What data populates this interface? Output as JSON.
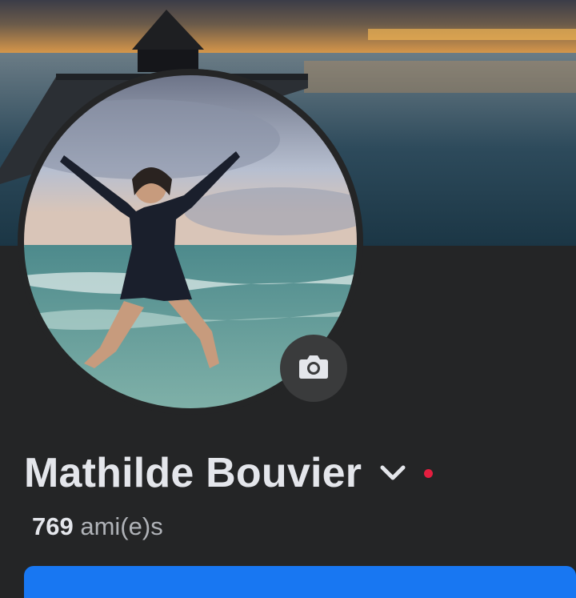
{
  "profile": {
    "name": "Mathilde Bouvier",
    "friends_count": "769",
    "friends_label": "ami(e)s"
  },
  "icons": {
    "camera": "camera-icon",
    "chevron": "chevron-down-icon",
    "status": "red-dot"
  },
  "colors": {
    "background": "#242526",
    "primary": "#1877f2",
    "status_dot": "#e41e3f",
    "text_primary": "#e4e6eb",
    "text_secondary": "#b0b3b8"
  }
}
